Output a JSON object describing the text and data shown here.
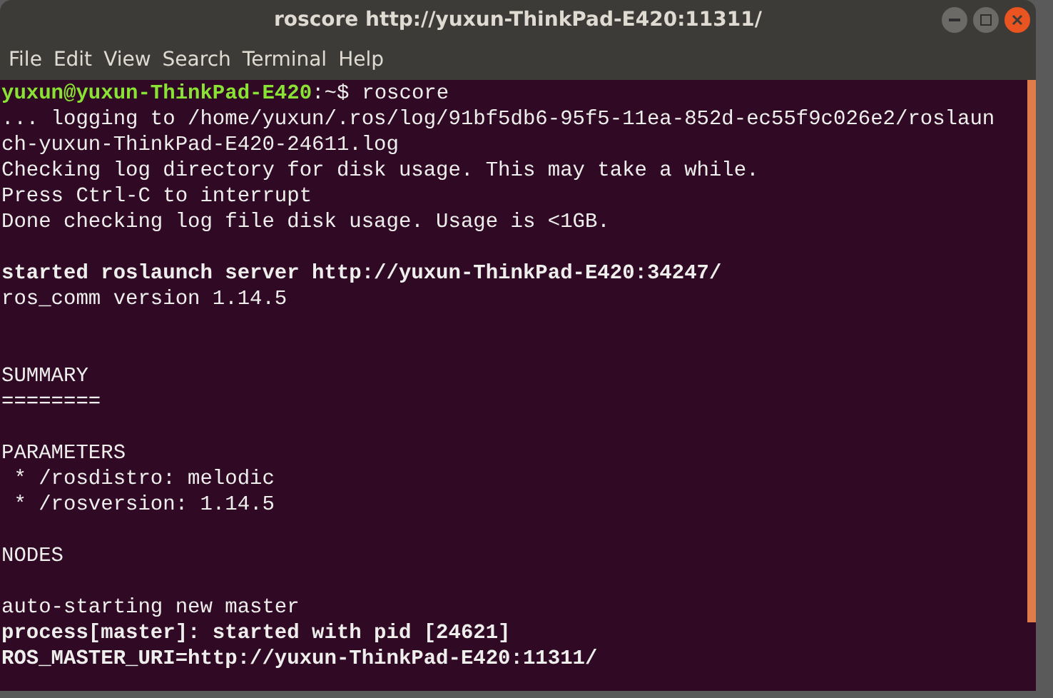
{
  "window": {
    "title": "roscore http://yuxun-ThinkPad-E420:11311/"
  },
  "menu": [
    "File",
    "Edit",
    "View",
    "Search",
    "Terminal",
    "Help"
  ],
  "lines": [
    {
      "kind": "prompt",
      "user_host": "yuxun@yuxun-ThinkPad-E420",
      "path": ":~$",
      "command": "roscore"
    },
    {
      "kind": "text",
      "text": "... logging to /home/yuxun/.ros/log/91bf5db6-95f5-11ea-852d-ec55f9c026e2/roslaun"
    },
    {
      "kind": "text",
      "text": "ch-yuxun-ThinkPad-E420-24611.log"
    },
    {
      "kind": "text",
      "text": "Checking log directory for disk usage. This may take a while."
    },
    {
      "kind": "text",
      "text": "Press Ctrl-C to interrupt"
    },
    {
      "kind": "text",
      "text": "Done checking log file disk usage. Usage is <1GB."
    },
    {
      "kind": "blank"
    },
    {
      "kind": "bold",
      "text": "started roslaunch server http://yuxun-ThinkPad-E420:34247/"
    },
    {
      "kind": "text",
      "text": "ros_comm version 1.14.5"
    },
    {
      "kind": "blank"
    },
    {
      "kind": "blank"
    },
    {
      "kind": "text",
      "text": "SUMMARY"
    },
    {
      "kind": "text",
      "text": "========"
    },
    {
      "kind": "blank"
    },
    {
      "kind": "text",
      "text": "PARAMETERS"
    },
    {
      "kind": "text",
      "text": " * /rosdistro: melodic"
    },
    {
      "kind": "text",
      "text": " * /rosversion: 1.14.5"
    },
    {
      "kind": "blank"
    },
    {
      "kind": "text",
      "text": "NODES"
    },
    {
      "kind": "blank"
    },
    {
      "kind": "text",
      "text": "auto-starting new master"
    },
    {
      "kind": "bold",
      "text": "process[master]: started with pid [24621]"
    },
    {
      "kind": "bold",
      "text": "ROS_MASTER_URI=http://yuxun-ThinkPad-E420:11311/"
    }
  ]
}
